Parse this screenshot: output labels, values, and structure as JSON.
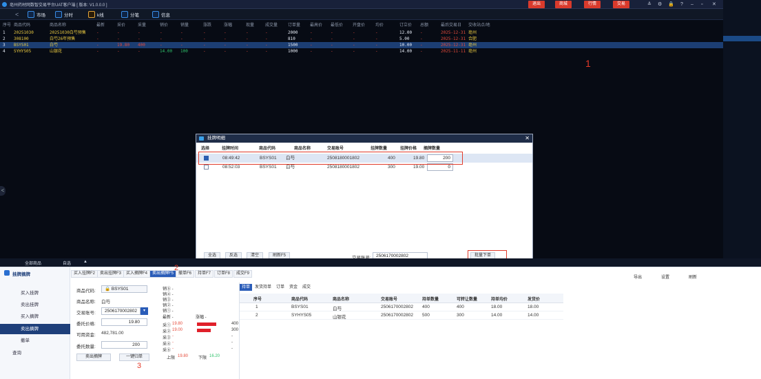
{
  "window": {
    "title": "亳州药材网数智交易平台UAT客户端 [ 版本: V1.0.0.0 ]",
    "btn_exit": "退出",
    "btn_mall": "商城",
    "btn_quotes": "行情",
    "btn_trade": "交易",
    "controls": [
      "≙",
      "⚙",
      "🔒",
      "?",
      "–",
      "▫",
      "✕"
    ]
  },
  "toolbar": {
    "market": "市场",
    "timeshare": "分时",
    "kline": "k线",
    "ticks": "分笔",
    "info": "信息"
  },
  "market": {
    "columns": [
      "序号",
      "商品代码",
      "商品名称",
      "最新",
      "采价",
      "采量",
      "销价",
      "销量",
      "涨跌",
      "涨幅",
      "现量",
      "成交量",
      "订单量",
      "最高价",
      "最低价",
      "开盘价",
      "均价",
      "订立价",
      "总额",
      "最后交易日",
      "交收站点/地"
    ],
    "rows": [
      {
        "no": "1",
        "code": "20251030",
        "name": "20251030白芍预售",
        "latest": "-",
        "buy": "-",
        "buyq": "-",
        "sell": "-",
        "sellq": "-",
        "chg": "-",
        "pct": "-",
        "cur": "-",
        "vol": "-",
        "orders": "2000",
        "high": "-",
        "low": "-",
        "open": "-",
        "avg": "-",
        "price": "12.00",
        "total": "-",
        "last": "2025-12-31",
        "site": "亳州"
      },
      {
        "no": "2",
        "code": "308100",
        "name": "白芍26年预售",
        "latest": "-",
        "buy": "-",
        "buyq": "-",
        "sell": "-",
        "sellq": "-",
        "chg": "-",
        "pct": "-",
        "cur": "-",
        "vol": "-",
        "orders": "810",
        "high": "-",
        "low": "-",
        "open": "-",
        "avg": "-",
        "price": "5.00",
        "total": "-",
        "last": "2025-12-31",
        "site": "合肥"
      },
      {
        "no": "3",
        "code": "BSYS01",
        "name": "白芍",
        "latest": "-",
        "buy": "19.80",
        "buyq": "400",
        "sell": "-",
        "sellq": "-",
        "chg": "-",
        "pct": "-",
        "cur": "-",
        "vol": "-",
        "orders": "1500",
        "high": "-",
        "low": "-",
        "open": "-",
        "avg": "-",
        "price": "10.00",
        "total": "-",
        "last": "2025-12-31",
        "site": "亳州"
      },
      {
        "no": "4",
        "code": "SYHYS05",
        "name": "山银花",
        "latest": "-",
        "buy": "-",
        "buyq": "-",
        "sell": "14.00",
        "sellq": "100",
        "chg": "-",
        "pct": "-",
        "cur": "-",
        "vol": "-",
        "orders": "1000",
        "high": "-",
        "low": "-",
        "open": "-",
        "avg": "-",
        "price": "14.00",
        "total": "-",
        "last": "2025-11-11",
        "site": "亳州"
      }
    ],
    "annotation": "1"
  },
  "dialog": {
    "title": "挂牌明细",
    "columns": [
      "选择",
      "挂牌时间",
      "商品代码",
      "商品名称",
      "交易账号",
      "挂牌数量",
      "挂牌价格",
      "摘牌数量"
    ],
    "rows": [
      {
        "time": "08:49:42",
        "code": "BSYS01",
        "name": "白芍",
        "account": "2508180001802",
        "qty": "400",
        "price": "19.80",
        "take": "200",
        "checked": true
      },
      {
        "time": "08:52:03",
        "code": "BSYS01",
        "name": "白芍",
        "account": "2508180001802",
        "qty": "300",
        "price": "19.00",
        "take": "0",
        "checked": false
      }
    ],
    "btn_all": "全选",
    "btn_invert": "反选",
    "btn_clear": "清空",
    "btn_refresh": "刷新F5",
    "account_label": "交易账号:",
    "account_value": "2506170002802",
    "btn_batch": "批量下单"
  },
  "bottombar": {
    "all": "全部商品",
    "fav": "自选",
    "up": "▲",
    "export": "导出",
    "settings": "设置",
    "refresh": "刷新"
  },
  "nav": {
    "title": "挂牌摘牌",
    "items": [
      "买入挂牌",
      "卖出挂牌",
      "买入摘牌",
      "卖出摘牌",
      "撤单",
      "查询"
    ]
  },
  "tabs": [
    "买入挂牌F2",
    "卖出挂牌F3",
    "买入摘牌F4",
    "卖出摘牌F5",
    "撤单F6",
    "持单F7",
    "订单F8",
    "成交F9"
  ],
  "form": {
    "code_label": "商品代码:",
    "code": "BSYS01",
    "name_label": "商品名称:",
    "name": "白芍",
    "account_label": "交易账号:",
    "account": "2506170002802",
    "price_label": "委托价格:",
    "price": "19.80",
    "funds_label": "可用资金:",
    "funds": "482,781.00",
    "qty_label": "委托数量:",
    "qty": "200",
    "btn_sell": "卖出摘牌",
    "btn_one": "一键归单",
    "annotation2": "2",
    "annotation3": "3"
  },
  "quotes": {
    "sells": [
      "销⑤  -",
      "销④  -",
      "销③  -",
      "销②  -",
      "销①  -"
    ],
    "latest": "最新  -",
    "chg": "涨幅  -",
    "buys": [
      {
        "l": "采①",
        "p": "19.80",
        "q": "400"
      },
      {
        "l": "采②",
        "p": "19.00",
        "q": "300"
      },
      {
        "l": "采③",
        "p": "-",
        "q": "-"
      },
      {
        "l": "采④",
        "p": "-",
        "q": "-"
      },
      {
        "l": "采⑤",
        "p": "-",
        "q": "-"
      }
    ],
    "upper_label": "上限",
    "upper": "19.80",
    "lower_label": "下限",
    "lower": "16.20"
  },
  "holdings": {
    "tabs": [
      "持单",
      "发货持单",
      "订单",
      "资金",
      "成交"
    ],
    "columns": [
      "序号",
      "商品代码",
      "商品名称",
      "交易账号",
      "持单数量",
      "可转让数量",
      "持单均价",
      "发货价"
    ],
    "rows": [
      {
        "no": "1",
        "code": "BSYS01",
        "name": "白芍",
        "account": "2506170002802",
        "qty": "400",
        "avail": "400",
        "avg": "18.00",
        "ship": "18.00"
      },
      {
        "no": "2",
        "code": "SYHYS05",
        "name": "山银花",
        "account": "2506170002802",
        "qty": "500",
        "avail": "300",
        "avg": "14.00",
        "ship": "14.00"
      }
    ]
  }
}
